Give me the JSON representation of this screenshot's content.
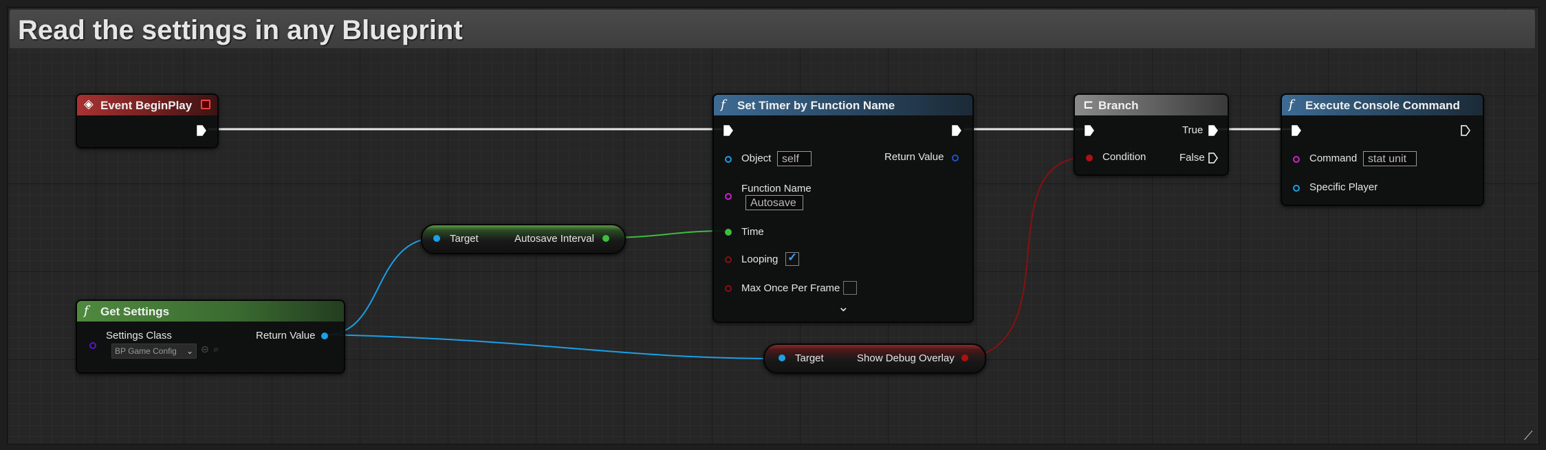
{
  "comment": {
    "title": "Read the settings in any Blueprint"
  },
  "nodes": {
    "event_begin_play": {
      "title": "Event BeginPlay"
    },
    "set_timer": {
      "title": "Set Timer by Function Name",
      "object_label": "Object",
      "object_value": "self",
      "return_value_label": "Return Value",
      "function_name_label": "Function Name",
      "function_name_value": "Autosave",
      "time_label": "Time",
      "looping_label": "Looping",
      "max_once_label": "Max Once Per Frame",
      "expand_glyph": "⌄"
    },
    "branch": {
      "title": "Branch",
      "condition_label": "Condition",
      "true_label": "True",
      "false_label": "False"
    },
    "execute_console": {
      "title": "Execute Console Command",
      "command_label": "Command",
      "command_value": "stat unit",
      "specific_player_label": "Specific Player"
    },
    "get_settings": {
      "title": "Get Settings",
      "settings_class_label": "Settings Class",
      "settings_class_value": "BP Game Config",
      "return_value_label": "Return Value"
    },
    "autosave_interval_getter": {
      "target_label": "Target",
      "output_label": "Autosave Interval"
    },
    "show_debug_overlay_getter": {
      "target_label": "Target",
      "output_label": "Show Debug Overlay"
    }
  },
  "colors": {
    "exec_wire": "#ffffff",
    "object_wire": "#1aa0e8",
    "float_wire": "#3cbf3c",
    "bool_wire": "#8a1010",
    "string_pin": "#d01fd0",
    "class_pin": "#5a16c8",
    "blue_pin": "#1f54c8"
  }
}
